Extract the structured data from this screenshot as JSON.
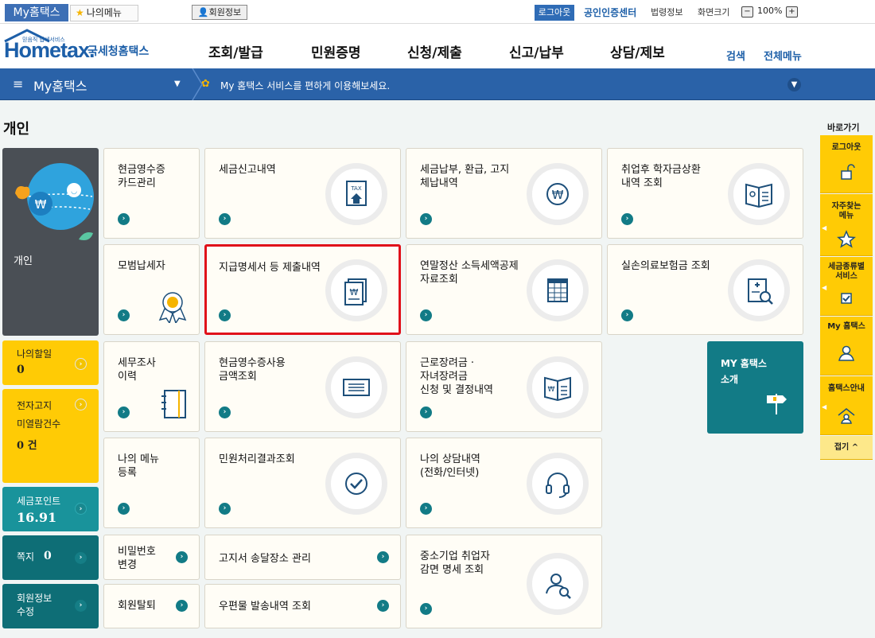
{
  "topbar": {
    "my_tab": "My홈택스",
    "my_menu": "나의메뉴",
    "member_info": "회원정보",
    "logout": "로그아웃",
    "cert_center": "공인인증센터",
    "law_info": "법령정보",
    "screen_size": "화면크기",
    "zoom": "100%",
    "zoom_minus": "−",
    "zoom_plus": "+"
  },
  "header": {
    "logo_tagline": "믿음직 납세서비스",
    "logo": "Hometax.",
    "logo_sub": "국세청홈택스",
    "nav": [
      "조회/발급",
      "민원증명",
      "신청/제출",
      "신고/납부",
      "상담/제보"
    ],
    "search": "검색",
    "all_menu": "전체메뉴"
  },
  "bluebar": {
    "menu_icon": "≡",
    "title": "My홈택스",
    "message": "My 홈택스 서비스를 편하게 이용해보세요."
  },
  "page_title": "개인",
  "profile": {
    "label": "개인"
  },
  "side_items": {
    "todo_label": "나의할일",
    "todo_count": "0",
    "notice_label": "전자고지\n미열람건수",
    "notice_count": "0 건",
    "points_label": "세금포인트",
    "points_value": "16.91",
    "message_label": "쪽지",
    "message_count": "0",
    "edit_label": "회원정보\n수정"
  },
  "cards": {
    "cash_receipt": "현금영수증\n카드관리",
    "tax_report": "세금신고내역",
    "payment": "세금납부, 환급, 고지\n체납내역",
    "student_loan": "취업후 학자금상환\n내역 조회",
    "model_taxpayer": "모범납세자",
    "payment_statement": "지급명세서 등 제출내역",
    "year_end": "연말정산 소득세액공제\n자료조회",
    "insurance": "실손의료보험금 조회",
    "tax_audit": "세무조사\n이력",
    "cash_usage": "현금영수증사용\n금액조회",
    "eitc": "근로장려금 ·\n자녀장려금\n신청 및 결정내역",
    "mymenu_reg": "나의 메뉴\n등록",
    "petition_result": "민원처리결과조회",
    "consult": "나의 상담내역\n(전화/인터넷)",
    "password": "비밀번호\n변경",
    "bill_place": "고지서 송달장소 관리",
    "sme_tax": "중소기업 취업자\n감면 명세 조회",
    "withdraw": "회원탈퇴",
    "mail_history": "우편물 발송내역 조회",
    "my_intro": "MY 홈택스\n소개"
  },
  "right_panel": {
    "title": "바로가기",
    "items": [
      "로그아웃",
      "자주찾는\n메뉴",
      "세금종류별\n서비스",
      "My 홈택스",
      "홈택스안내"
    ],
    "fold": "접기 ^"
  },
  "colors": {
    "accent_blue": "#2a62a8",
    "teal": "#127b86",
    "yellow": "#ffcb05",
    "highlight": "#e0101a"
  }
}
